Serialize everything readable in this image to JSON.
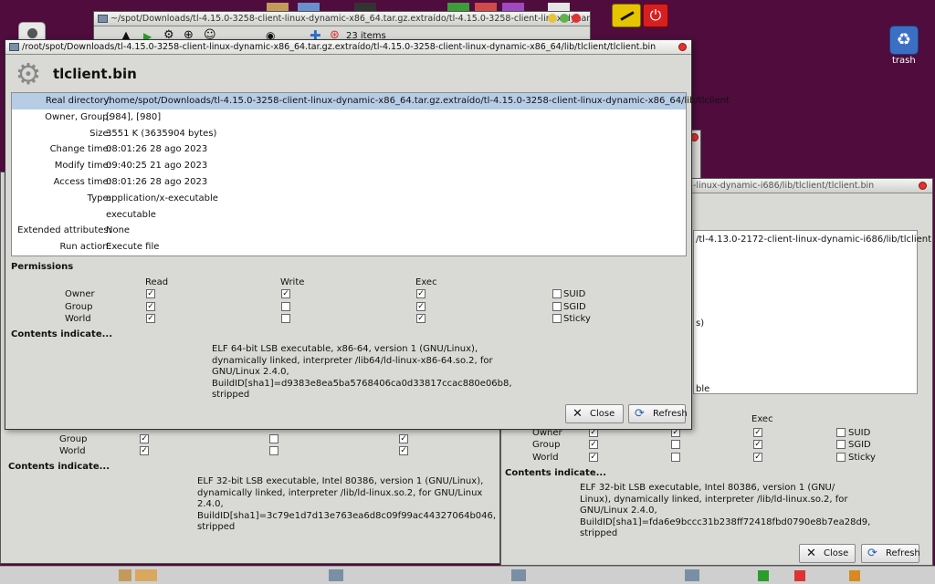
{
  "desktop": {
    "trash_label": "trash"
  },
  "file_manager_window": {
    "title": "~/spot/Downloads/tl-4.15.0-3258-client-linux-dynamic-x86_64.tar.gz.extraído/tl-4.15.0-3258-client-linux-dynamic-x86_64",
    "item_count": "23 items"
  },
  "main_dialog": {
    "title": "/root/spot/Downloads/tl-4.15.0-3258-client-linux-dynamic-x86_64.tar.gz.extraído/tl-4.15.0-3258-client-linux-dynamic-x86_64/lib/tlclient/tlclient.bin",
    "file_name": "tlclient.bin",
    "properties": [
      {
        "key": "Real directory:",
        "value": "/home/spot/Downloads/tl-4.15.0-3258-client-linux-dynamic-x86_64.tar.gz.extraído/tl-4.15.0-3258-client-linux-dynamic-x86_64/lib/tlclient"
      },
      {
        "key": "Owner, Group:",
        "value": "[984], [980]"
      },
      {
        "key": "Size:",
        "value": "3551 K (3635904 bytes)"
      },
      {
        "key": "Change time:",
        "value": "08:01:26 28 ago 2023"
      },
      {
        "key": "Modify time:",
        "value": "09:40:25 21 ago 2023"
      },
      {
        "key": "Access time:",
        "value": "08:01:26 28 ago 2023"
      },
      {
        "key": "Type:",
        "value": "application/x-executable"
      },
      {
        "key": "",
        "value": "executable"
      },
      {
        "key": "Extended attributes:",
        "value": "None"
      },
      {
        "key": "Run action:",
        "value": "Execute file"
      }
    ],
    "permissions_heading": "Permissions",
    "perm_columns": [
      "Read",
      "Write",
      "Exec"
    ],
    "perm_rows": [
      {
        "label": "Owner",
        "read": true,
        "write": true,
        "exec": true,
        "special": "SUID",
        "special_checked": false
      },
      {
        "label": "Group",
        "read": true,
        "write": false,
        "exec": true,
        "special": "SGID",
        "special_checked": false
      },
      {
        "label": "World",
        "read": true,
        "write": false,
        "exec": true,
        "special": "Sticky",
        "special_checked": false
      }
    ],
    "contents_heading": "Contents indicate...",
    "contents_lines": [
      "ELF 64-bit LSB executable, x86-64, version 1 (GNU/Linux),",
      "dynamically linked, interpreter /lib64/ld-linux-x86-64.so.2, for",
      "GNU/Linux 2.4.0,",
      "BuildID[sha1]=d9383e8ea5ba5768406ca0d33817ccac880e06b8,",
      "stripped"
    ],
    "close_label": "Close",
    "refresh_label": "Refresh"
  },
  "back_left_dialog": {
    "perm_rows": [
      {
        "label": "Group",
        "read": true,
        "write": false,
        "exec": true
      },
      {
        "label": "World",
        "read": true,
        "write": false,
        "exec": true
      }
    ],
    "contents_heading": "Contents indicate...",
    "contents_lines": [
      "ELF 32-bit LSB executable, Intel 80386, version 1 (GNU/Linux),",
      "dynamically linked, interpreter /lib/ld-linux.so.2, for GNU/Linux",
      "2.4.0,",
      "BuildID[sha1]=3c79e1d7d13e763ea6d8c09f99ac44327064b046,",
      "stripped"
    ]
  },
  "back_right_dialog": {
    "title_fragment": "-linux-dynamic-i686/lib/tlclient/tlclient.bin",
    "dir_fragment": "/tl-4.13.0-2172-client-linux-dynamic-i686/lib/tlclient",
    "size_fragment": "s)",
    "type_fragment": "ble",
    "exec_header": "Exec",
    "perm_rows": [
      {
        "label": "Owner",
        "read": true,
        "write": true,
        "exec": true,
        "special": "SUID",
        "special_checked": false
      },
      {
        "label": "Group",
        "read": true,
        "write": false,
        "exec": true,
        "special": "SGID",
        "special_checked": false
      },
      {
        "label": "World",
        "read": true,
        "write": false,
        "exec": true,
        "special": "Sticky",
        "special_checked": false
      }
    ],
    "contents_heading": "Contents indicate...",
    "contents_lines": [
      "ELF 32-bit LSB executable, Intel 80386, version 1 (GNU/",
      "Linux), dynamically linked, interpreter /lib/ld-linux.so.2, for",
      "GNU/Linux 2.4.0,",
      "BuildID[sha1]=fda6e9bccc31b238ff72418fbd0790e8b7ea28d9,",
      "stripped"
    ],
    "close_label": "Close",
    "refresh_label": "Refresh"
  }
}
